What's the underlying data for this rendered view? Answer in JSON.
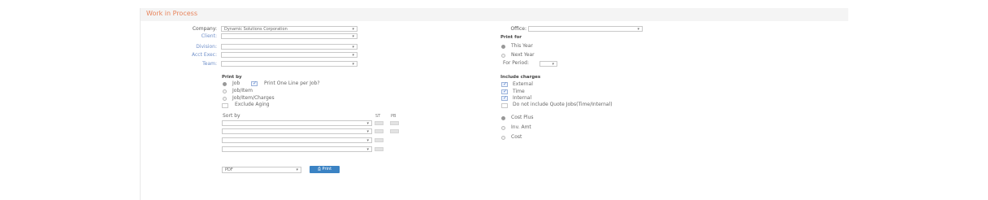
{
  "section_title": "Work in Process",
  "left_form": {
    "company": {
      "label": "Company:",
      "value": "Dynamic Solutions Corporation"
    },
    "client": {
      "label": "Client:",
      "value": ""
    },
    "division": {
      "label": "Division:",
      "value": ""
    },
    "acct_exec": {
      "label": "Acct Exec:",
      "value": ""
    },
    "team": {
      "label": "Team:",
      "value": ""
    }
  },
  "right_form": {
    "office": {
      "label": "Office:",
      "value": ""
    },
    "print_for": {
      "heading": "Print for",
      "options": [
        "This Year",
        "Next Year"
      ],
      "selected": 0,
      "for_period_label": "For Period:",
      "for_period_value": ""
    }
  },
  "print_by": {
    "heading": "Print by",
    "options": [
      "Job",
      "Job/Item",
      "Job/Item/Charges"
    ],
    "selected": 0,
    "one_line_label": "Print One Line per Job?",
    "one_line_checked": true,
    "exclude_aging_label": "Exclude Aging",
    "exclude_aging_checked": false
  },
  "include_charges": {
    "heading": "Include charges",
    "items": [
      {
        "label": "External",
        "checked": true
      },
      {
        "label": "Time",
        "checked": true
      },
      {
        "label": "Internal",
        "checked": true
      },
      {
        "label": "Do not include Quote Jobs(Time/Internal)",
        "checked": false
      }
    ]
  },
  "sort_by": {
    "heading": "Sort by",
    "col_st": "ST",
    "col_pb": "PB",
    "rows": [
      "",
      "",
      "",
      ""
    ]
  },
  "cost_basis": {
    "options": [
      "Cost Plus",
      "Inv. Amt",
      "Cost"
    ],
    "selected": 0
  },
  "footer": {
    "format_value": "PDF",
    "print_button": "Print"
  }
}
